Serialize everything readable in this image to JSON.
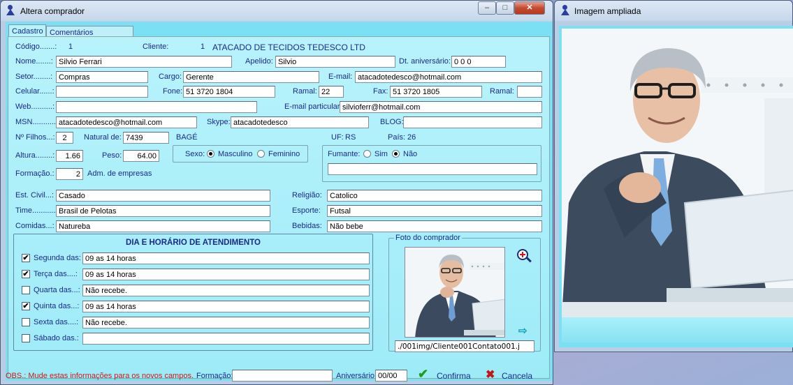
{
  "main_window": {
    "title": "Altera comprador",
    "min": "–",
    "max": "□",
    "close": "✕"
  },
  "tabs": [
    "Cadastro",
    "Comentários estratégicos"
  ],
  "fields": {
    "codigo_label": "Código.......:",
    "codigo": "1",
    "cliente_label": "Cliente:",
    "cliente_num": "1",
    "cliente_nome": "ATACADO DE TECIDOS TEDESCO LTD",
    "nome_label": "Nome.......:",
    "nome": "Silvio Ferrari",
    "apelido_label": "Apelido:",
    "apelido": "Silvio",
    "aniv_label": "Dt. aniversário:",
    "aniv": "0 0  0",
    "setor_label": "Setor........:",
    "setor": "Compras",
    "cargo_label": "Cargo:",
    "cargo": "Gerente",
    "email_label": "E-mail:",
    "email": "atacadotedesco@hotmail.com",
    "celular_label": "Celular......:",
    "celular": "",
    "fone_label": "Fone:",
    "fone": "51 3720 1804",
    "ramal_label": "Ramal:",
    "ramal": "22",
    "fax_label": "Fax:",
    "fax": "51 3720 1805",
    "ramal2_label": "Ramal:",
    "ramal2": "",
    "web_label": "Web..........:",
    "web": "",
    "email_part_label": "E-mail particular:",
    "email_part": "silvioferr@hotmail.com",
    "msn_label": "MSN...........:",
    "msn": "atacadotedesco@hotmail.com",
    "skype_label": "Skype:",
    "skype": "atacadotedesco",
    "blog_label": "BLOG:",
    "blog": "",
    "filhos_label": "Nº Filhos...:",
    "filhos": "2",
    "natural_label": "Natural de:",
    "natural": "7439",
    "cidade": "BAGÉ",
    "uf_label": "UF:",
    "uf": "RS",
    "pais_label": "País:",
    "pais": "26",
    "altura_label": "Altura........:",
    "altura": "1.66",
    "peso_label": "Peso:",
    "peso": "64.00",
    "sexo_label": "Sexo:",
    "sexo_m": "Masculino",
    "sexo_f": "Feminino",
    "fumante_label": "Fumante:",
    "fum_sim": "Sim",
    "fum_nao": "Não",
    "fumante_obs": "",
    "formacao_label": "Formação.:",
    "formacao": "2",
    "formacao_desc": "Adm. de empresas",
    "estcivil_label": "Est. Civil...:",
    "estcivil": "Casado",
    "religiao_label": "Religião:",
    "religiao": "Catolico",
    "time_label": "Time...........:",
    "time": "Brasil de Pelotas",
    "esporte_label": "Esporte:",
    "esporte": "Futsal",
    "comidas_label": "Comidas...:",
    "comidas": "Natureba",
    "bebidas_label": "Bebidas:",
    "bebidas": "Não bebe"
  },
  "schedule": {
    "title": "DIA E HORÁRIO DE ATENDIMENTO",
    "rows": [
      {
        "label": "Segunda das:",
        "checked": "✔",
        "value": "09 as 14 horas"
      },
      {
        "label": "Terça das....:",
        "checked": "✔",
        "value": "09 as 14 horas"
      },
      {
        "label": "Quarta das...:",
        "checked": "",
        "value": "Não recebe."
      },
      {
        "label": "Quinta das...:",
        "checked": "✔",
        "value": "09 as 14 horas"
      },
      {
        "label": "Sexta das....:",
        "checked": "",
        "value": "Não recebe."
      },
      {
        "label": "Sábado das.:",
        "checked": "",
        "value": ""
      }
    ]
  },
  "photo": {
    "title": "Foto do comprador",
    "path": "./001img/Cliente001Contato001.j"
  },
  "footer": {
    "obs": "OBS.: Mude estas informações para os novos campos.",
    "formacao_label": "Formação:",
    "formacao": "",
    "aniversario_label": "Aniversário:",
    "aniversario": "00/00",
    "confirma": "Confirma",
    "cancela": "Cancela"
  },
  "zoom_window": {
    "title": "Imagem ampliada"
  },
  "colors": {
    "form_bg": "#b8f3fc",
    "label": "#1a2a8a",
    "obs_red": "#d01818"
  }
}
